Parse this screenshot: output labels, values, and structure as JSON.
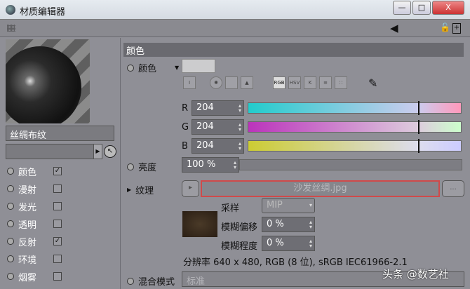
{
  "window": {
    "title": "材质编辑器",
    "minimize": "—",
    "maximize": "□",
    "close": "X"
  },
  "left": {
    "material_name": "丝绸布纹",
    "channels": [
      {
        "label": "颜色",
        "checked": true
      },
      {
        "label": "漫射",
        "checked": false
      },
      {
        "label": "发光",
        "checked": false
      },
      {
        "label": "透明",
        "checked": false
      },
      {
        "label": "反射",
        "checked": true
      },
      {
        "label": "环境",
        "checked": false
      },
      {
        "label": "烟雾",
        "checked": false
      }
    ]
  },
  "main": {
    "section": "颜色",
    "color_label": "颜色",
    "icons": [
      "RGB",
      "HSV",
      "K"
    ],
    "r_label": "R",
    "r": "204",
    "g_label": "G",
    "g": "204",
    "b_label": "B",
    "b": "204",
    "brightness_label": "亮度",
    "brightness": "100 %",
    "texture_label": "纹理",
    "texture_file": "沙发丝绸.jpg",
    "browse": "...",
    "sampling_label": "采样",
    "sampling": "MIP",
    "blur_offset_label": "模糊偏移",
    "blur_offset": "0 %",
    "blur_scale_label": "模糊程度",
    "blur_scale": "0 %",
    "info": "分辨率 640 x 480, RGB (8 位), sRGB IEC61966-2.1",
    "blend_label": "混合模式",
    "blend": "标准"
  },
  "watermark": "头条 @数艺社",
  "check_glyph": "✓"
}
